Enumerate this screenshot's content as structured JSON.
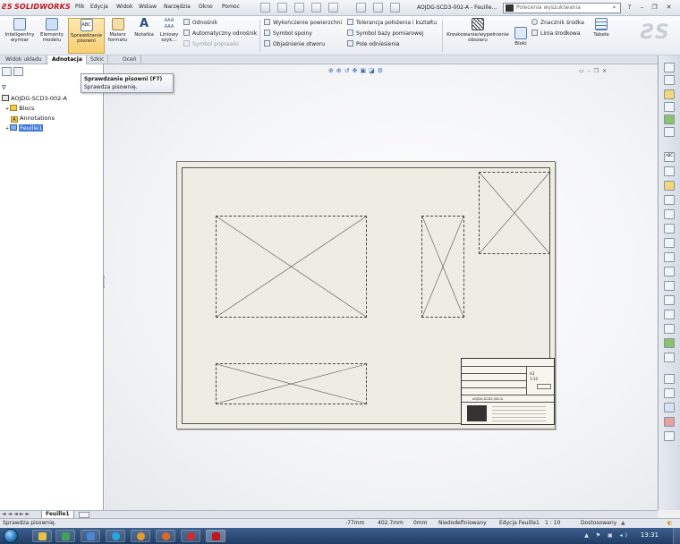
{
  "app": {
    "logo_text": "SOLIDWORKS",
    "document_title": "AOJDG-SCD3-002-A - Feuille...",
    "search_placeholder": "Polecenia wyszukiwania"
  },
  "menu": [
    "Plik",
    "Edycja",
    "Widok",
    "Wstaw",
    "Narzędzia",
    "Okno",
    "Pomoc"
  ],
  "ribbon": {
    "smart_dimension": "Inteligentny wymiar",
    "model_items": "Elementy modelu",
    "spell_check": "Sprawdzanie pisowni",
    "format_painter": "Malarz formatu",
    "note": "Notatka",
    "linear_pattern": "Liniowy szyk...",
    "balloon": "Odnośnik",
    "auto_balloon": "Automatyczny odnośnik",
    "magnetic_line": "Symbol poprawki",
    "surface_finish": "Wykończenie powierzchni",
    "weld_symbol": "Symbol spoiny",
    "hole_callout": "Objaśnienie otworu",
    "geo_tolerance": "Tolerancja położenia i kształtu",
    "datum_feature": "Symbol bazy pomiarowej",
    "datum_target": "Pole odniesienia",
    "hatch": "Kreskowanie/wypełnienie obszaru",
    "blocks": "Bloki",
    "center_mark": "Znacznik środka",
    "centerline": "Linia środkowa",
    "tables": "Tabele"
  },
  "tabs": [
    "Widok układu",
    "Adnotacja",
    "Szkic",
    "Oceń"
  ],
  "tooltip": {
    "title": "Sprawdzanie pisowni   (F7)",
    "body": "Sprawdza pisownię."
  },
  "tree": {
    "root": "AOJDG-SCD3-002-A",
    "items": [
      "Blocs",
      "Annotations",
      "Feuille1"
    ]
  },
  "sheet_tab": "Feuille1",
  "status": {
    "message": "Sprawdza pisownię.",
    "x": "-77mm",
    "y": "402.7mm",
    "z": "0mm",
    "definition": "Niedodefiniowany",
    "editing": "Edycja Feuille1",
    "scale": "1 : 10",
    "custom": "Dostosowany"
  },
  "clock": "13:31",
  "title_block": {
    "size": "A3",
    "scale": "1:10",
    "drawing_no": "AOJDG-SCD3-002-A"
  },
  "colors": {
    "accent_red": "#c0161e",
    "selection_blue": "#3c78d8",
    "active_button": "#f8cf72"
  }
}
